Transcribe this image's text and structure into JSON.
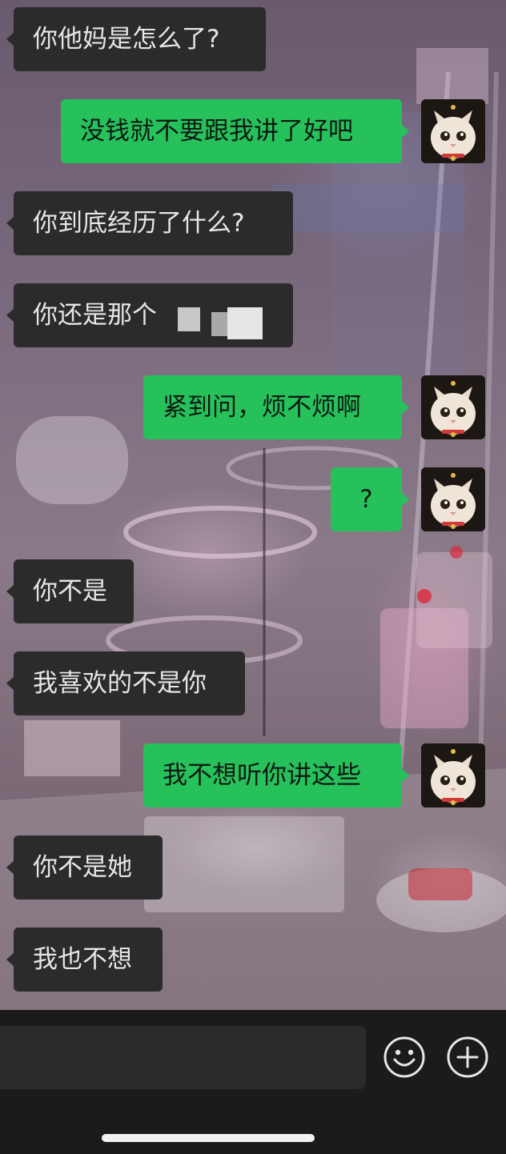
{
  "chat": {
    "messages": [
      {
        "side": "in",
        "text": "你他妈是怎么了?"
      },
      {
        "side": "out",
        "text": "没钱就不要跟我讲了好吧"
      },
      {
        "side": "in",
        "text": "你到底经历了什么?"
      },
      {
        "side": "in",
        "text": "你还是那个"
      },
      {
        "side": "out",
        "text": "紧到问，烦不烦啊"
      },
      {
        "side": "out",
        "text": "?"
      },
      {
        "side": "in",
        "text": "你不是"
      },
      {
        "side": "in",
        "text": "我喜欢的不是你"
      },
      {
        "side": "out",
        "text": "我不想听你讲这些"
      },
      {
        "side": "in",
        "text": "你不是她"
      },
      {
        "side": "in",
        "text": "我也不想"
      }
    ]
  },
  "composer": {
    "value": "",
    "emoji_icon": "smiley-icon",
    "plus_icon": "plus-circle-icon"
  },
  "colors": {
    "outgoing_bubble": "#27c15c",
    "incoming_bubble": "#2b2b2b",
    "bar_background": "#1b1b1b"
  }
}
